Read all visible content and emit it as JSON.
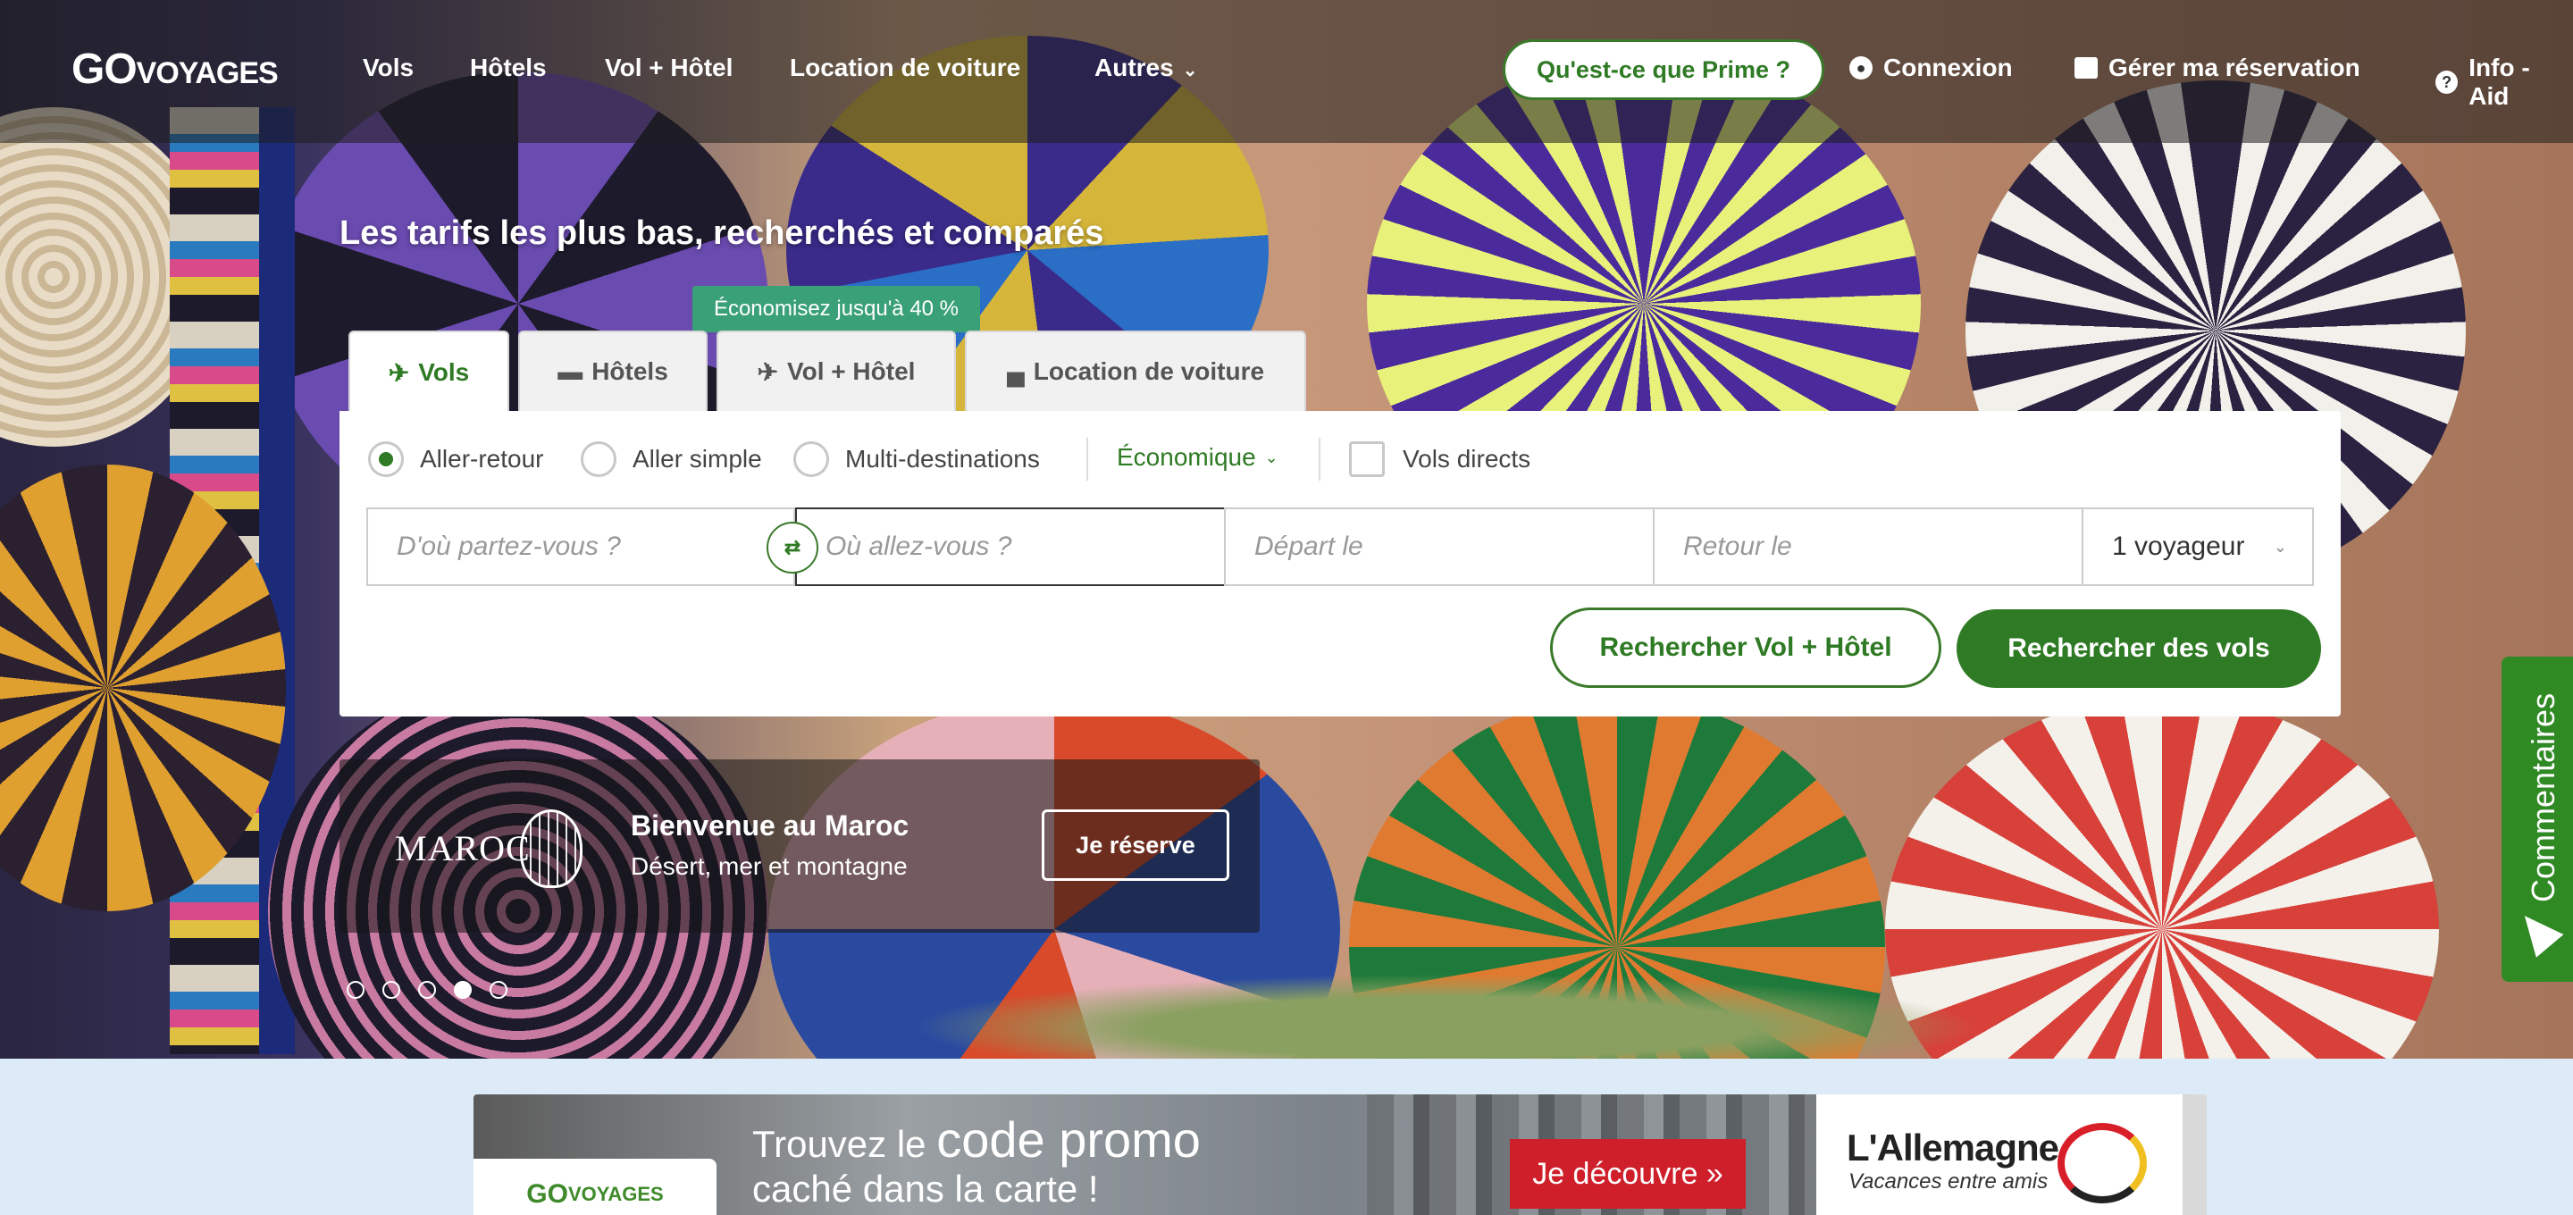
{
  "nav": {
    "logo_big": "GO",
    "logo_small": "VOYAGES",
    "links": [
      "Vols",
      "Hôtels",
      "Vol + Hôtel",
      "Location de voiture"
    ],
    "more_label": "Autres",
    "prime_label": "Qu'est-ce que Prime ?",
    "login_label": "Connexion",
    "manage_label": "Gérer ma réservation",
    "help_label": "Info - Aid"
  },
  "hero": {
    "title": "Les tarifs les plus bas, recherchés et comparés",
    "promo_tag": "Économisez jusqu'à 40 %"
  },
  "tabs": [
    {
      "label": "Vols",
      "icon": "plane-icon",
      "active": true
    },
    {
      "label": "Hôtels",
      "icon": "bed-icon",
      "active": false
    },
    {
      "label": "Vol + Hôtel",
      "icon": "plane-hotel-icon",
      "active": false
    },
    {
      "label": "Location de voiture",
      "icon": "car-icon",
      "active": false
    }
  ],
  "search": {
    "trip_types": [
      "Aller-retour",
      "Aller simple",
      "Multi-destinations"
    ],
    "selected_trip": "Aller-retour",
    "cabin": "Économique",
    "direct_label": "Vols directs",
    "from_placeholder": "D'où partez-vous ?",
    "to_placeholder": "Où allez-vous ?",
    "depart_placeholder": "Départ le",
    "return_placeholder": "Retour le",
    "travelers": "1 voyageur",
    "btn_flight_hotel": "Rechercher Vol + Hôtel",
    "btn_flights": "Rechercher des vols"
  },
  "promo": {
    "brand": "MAROC",
    "title": "Bienvenue au Maroc",
    "subtitle": "Désert, mer et montagne",
    "cta": "Je réserve",
    "carousel_active": 4,
    "carousel_count": 5
  },
  "feedback": {
    "label": "Commentaires"
  },
  "banner": {
    "logo_big": "GO",
    "logo_small": "VOYAGES",
    "line1_pre": "Trouvez le",
    "line1_big": "code promo",
    "line2": "caché dans la carte !",
    "cta": "Je découvre »",
    "right_title": "L'Allemagne",
    "right_sub": "Vacances entre amis"
  },
  "colors": {
    "brand_green": "#2f7a24",
    "promo_tag": "#3aa078",
    "banner_red": "#cf1f2a"
  }
}
